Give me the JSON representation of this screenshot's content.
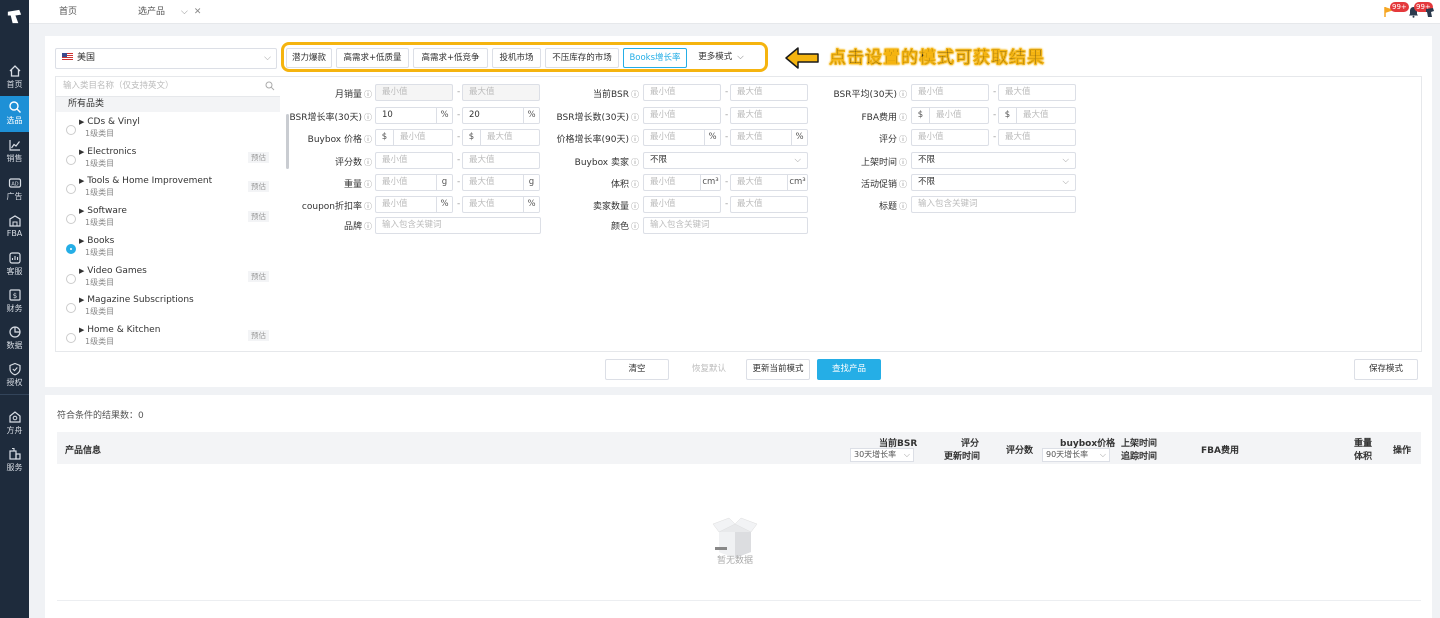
{
  "nav": {
    "items": [
      {
        "label": "首页",
        "icon": "home-icon"
      },
      {
        "label": "选品",
        "icon": "search-icon"
      },
      {
        "label": "销售",
        "icon": "chart-line-icon"
      },
      {
        "label": "广告",
        "icon": "ad-icon"
      },
      {
        "label": "FBA",
        "icon": "warehouse-icon"
      },
      {
        "label": "客服",
        "icon": "service-icon"
      },
      {
        "label": "财务",
        "icon": "finance-icon"
      },
      {
        "label": "数据",
        "icon": "pie-chart-icon"
      },
      {
        "label": "授权",
        "icon": "shield-icon"
      },
      {
        "label": "方舟",
        "icon": "ark-icon"
      },
      {
        "label": "服务",
        "icon": "building-icon"
      }
    ],
    "active": 1
  },
  "tabs": [
    {
      "label": "首页"
    },
    {
      "label": "选产品"
    }
  ],
  "topbar": {
    "badge1": "99+",
    "badge2": "99+"
  },
  "filters": {
    "country": "美国",
    "modes": [
      "潜力爆款",
      "高需求+低质量",
      "高需求+低竞争",
      "投机市场",
      "不压库存的市场",
      "Books增长率",
      "更多模式"
    ],
    "active_mode": 5,
    "hint": "点击设置的模式可获取结果"
  },
  "categories": {
    "search_placeholder": "输入类目名称（仅支持英文）",
    "all_label": "所有品类",
    "level_label": "1级类目",
    "estimate_label": "预估",
    "items": [
      {
        "name": "CDs & Vinyl",
        "est": false,
        "checked": false
      },
      {
        "name": "Electronics",
        "est": true,
        "checked": false
      },
      {
        "name": "Tools & Home Improvement",
        "est": true,
        "checked": false
      },
      {
        "name": "Software",
        "est": true,
        "checked": false
      },
      {
        "name": "Books",
        "est": false,
        "checked": true
      },
      {
        "name": "Video Games",
        "est": true,
        "checked": false
      },
      {
        "name": "Magazine Subscriptions",
        "est": false,
        "checked": false
      },
      {
        "name": "Home & Kitchen",
        "est": true,
        "checked": false
      }
    ]
  },
  "form": {
    "min": "最小值",
    "max": "最大值",
    "keyword_placeholder": "输入包含关键词",
    "any": "不限",
    "fields": {
      "monthly_sales": "月销量",
      "bsr_growth_rate": "BSR增长率(30天)",
      "buybox_price": "Buybox 价格",
      "review_count": "评分数",
      "weight": "重量",
      "coupon_rate": "coupon折扣率",
      "brand": "品牌",
      "current_bsr": "当前BSR",
      "bsr_growth_count": "BSR增长数(30天)",
      "price_growth": "价格增长率(90天)",
      "buybox_seller": "Buybox 卖家",
      "volume": "体积",
      "seller_count": "卖家数量",
      "color": "颜色",
      "bsr_avg": "BSR平均(30天)",
      "fba_fee": "FBA费用",
      "rating": "评分",
      "listing_time": "上架时间",
      "promotion": "活动促销",
      "title": "标题"
    },
    "bsr_growth_min": "10",
    "bsr_growth_max": "20",
    "units": {
      "percent": "%",
      "dollar": "$",
      "gram": "g",
      "cm3": "cm³"
    }
  },
  "buttons": {
    "clear": "清空",
    "restore": "恢复默认",
    "update_mode": "更新当前模式",
    "search": "查找产品",
    "save_mode": "保存模式"
  },
  "results": {
    "count_label": "符合条件的结果数：0",
    "columns": {
      "product_info": "产品信息",
      "current_bsr": "当前BSR",
      "growth_30": "30天增长率",
      "rating": "评分",
      "update_time": "更新时间",
      "review_count": "评分数",
      "buybox_price": "buybox价格",
      "growth_90": "90天增长率",
      "listing_time": "上架时间",
      "track_time": "追踪时间",
      "fba_fee": "FBA费用",
      "weight": "重量",
      "volume": "体积",
      "actions": "操作"
    },
    "empty": "暂无数据"
  }
}
